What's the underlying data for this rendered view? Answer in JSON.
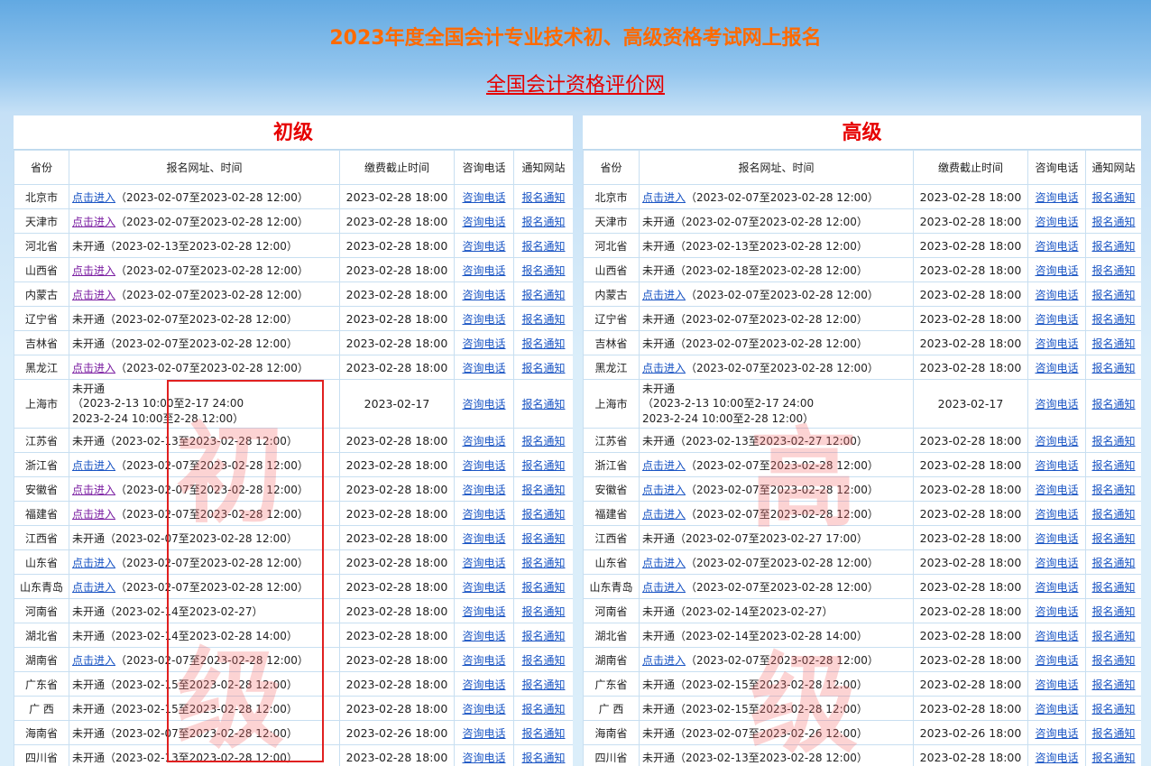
{
  "title": "2023年度全国会计专业技术初、高级资格考试网上报名",
  "site_link": "全国会计资格评价网",
  "headers": [
    "省份",
    "报名网址、时间",
    "缴费截止时间",
    "咨询电话",
    "通知网站"
  ],
  "consult_label": "咨询电话",
  "notice_label": "报名通知",
  "link_label": "点击进入",
  "watermarks": {
    "primary_top": "初",
    "primary_bottom": "级",
    "senior_top": "高",
    "senior_bottom": "级"
  },
  "colors": {
    "title": "#ff6a00",
    "link": "#1a55c4",
    "visited_link": "#7b1fa2",
    "panel_title": "#e60000",
    "highlight_box": "#e02020"
  },
  "primary": {
    "title": "初级",
    "rows": [
      {
        "province": "北京市",
        "status": "点击进入",
        "link": true,
        "visited": false,
        "period": "（2023-02-07至2023-02-28 12:00）",
        "deadline": "2023-02-28 18:00"
      },
      {
        "province": "天津市",
        "status": "点击进入",
        "link": true,
        "visited": true,
        "period": "（2023-02-07至2023-02-28 12:00）",
        "deadline": "2023-02-28 18:00"
      },
      {
        "province": "河北省",
        "status": "未开通",
        "link": false,
        "period": "（2023-02-13至2023-02-28 12:00）",
        "deadline": "2023-02-28 18:00"
      },
      {
        "province": "山西省",
        "status": "点击进入",
        "link": true,
        "visited": true,
        "period": "（2023-02-07至2023-02-28 12:00）",
        "deadline": "2023-02-28 18:00"
      },
      {
        "province": "内蒙古",
        "status": "点击进入",
        "link": true,
        "visited": true,
        "period": "（2023-02-07至2023-02-28 12:00）",
        "deadline": "2023-02-28 18:00"
      },
      {
        "province": "辽宁省",
        "status": "未开通",
        "link": false,
        "period": "（2023-02-07至2023-02-28 12:00）",
        "deadline": "2023-02-28 18:00"
      },
      {
        "province": "吉林省",
        "status": "未开通",
        "link": false,
        "period": "（2023-02-07至2023-02-28 12:00）",
        "deadline": "2023-02-28 18:00"
      },
      {
        "province": "黑龙江",
        "status": "点击进入",
        "link": true,
        "visited": true,
        "period": "（2023-02-07至2023-02-28 12:00）",
        "deadline": "2023-02-28 18:00"
      },
      {
        "province": "上海市",
        "status": "未开通",
        "link": false,
        "multi": true,
        "line2": "（2023-2-13 10:00至2-17 24:00",
        "line3": "2023-2-24 10:00至2-28 12:00）",
        "deadline": "2023-02-17"
      },
      {
        "province": "江苏省",
        "status": "未开通",
        "link": false,
        "period": "（2023-02-13至2023-02-28 12:00）",
        "deadline": "2023-02-28 18:00"
      },
      {
        "province": "浙江省",
        "status": "点击进入",
        "link": true,
        "visited": false,
        "period": "（2023-02-07至2023-02-28 12:00）",
        "deadline": "2023-02-28 18:00"
      },
      {
        "province": "安徽省",
        "status": "点击进入",
        "link": true,
        "visited": true,
        "period": "（2023-02-07至2023-02-28 12:00）",
        "deadline": "2023-02-28 18:00"
      },
      {
        "province": "福建省",
        "status": "点击进入",
        "link": true,
        "visited": true,
        "period": "（2023-02-07至2023-02-28 12:00）",
        "deadline": "2023-02-28 18:00"
      },
      {
        "province": "江西省",
        "status": "未开通",
        "link": false,
        "period": "（2023-02-07至2023-02-28 12:00）",
        "deadline": "2023-02-28 18:00"
      },
      {
        "province": "山东省",
        "status": "点击进入",
        "link": true,
        "visited": false,
        "period": "（2023-02-07至2023-02-28 12:00）",
        "deadline": "2023-02-28 18:00"
      },
      {
        "province": "山东青岛",
        "status": "点击进入",
        "link": true,
        "visited": false,
        "period": "（2023-02-07至2023-02-28 12:00）",
        "deadline": "2023-02-28 18:00"
      },
      {
        "province": "河南省",
        "status": "未开通",
        "link": false,
        "period": "（2023-02-14至2023-02-27）",
        "deadline": "2023-02-28 18:00"
      },
      {
        "province": "湖北省",
        "status": "未开通",
        "link": false,
        "period": "（2023-02-14至2023-02-28 14:00）",
        "deadline": "2023-02-28 18:00"
      },
      {
        "province": "湖南省",
        "status": "点击进入",
        "link": true,
        "visited": false,
        "period": "（2023-02-07至2023-02-28 12:00）",
        "deadline": "2023-02-28 18:00"
      },
      {
        "province": "广东省",
        "status": "未开通",
        "link": false,
        "period": "（2023-02-15至2023-02-28 12:00）",
        "deadline": "2023-02-28 18:00"
      },
      {
        "province": "广 西",
        "status": "未开通",
        "link": false,
        "period": "（2023-02-15至2023-02-28 12:00）",
        "deadline": "2023-02-28 18:00"
      },
      {
        "province": "海南省",
        "status": "未开通",
        "link": false,
        "period": "（2023-02-07至2023-02-28 12:00）",
        "deadline": "2023-02-26 18:00"
      },
      {
        "province": "四川省",
        "status": "未开通",
        "link": false,
        "period": "（2023-02-13至2023-02-28 12:00）",
        "deadline": "2023-02-28 18:00"
      }
    ]
  },
  "senior": {
    "title": "高级",
    "rows": [
      {
        "province": "北京市",
        "status": "点击进入",
        "link": true,
        "visited": false,
        "period": "（2023-02-07至2023-02-28 12:00）",
        "deadline": "2023-02-28 18:00"
      },
      {
        "province": "天津市",
        "status": "未开通",
        "link": false,
        "period": "（2023-02-07至2023-02-28 12:00）",
        "deadline": "2023-02-28 18:00"
      },
      {
        "province": "河北省",
        "status": "未开通",
        "link": false,
        "period": "（2023-02-13至2023-02-28 12:00）",
        "deadline": "2023-02-28 18:00"
      },
      {
        "province": "山西省",
        "status": "未开通",
        "link": false,
        "period": "（2023-02-18至2023-02-28 12:00）",
        "deadline": "2023-02-28 18:00"
      },
      {
        "province": "内蒙古",
        "status": "点击进入",
        "link": true,
        "visited": false,
        "period": "（2023-02-07至2023-02-28 12:00）",
        "deadline": "2023-02-28 18:00"
      },
      {
        "province": "辽宁省",
        "status": "未开通",
        "link": false,
        "period": "（2023-02-07至2023-02-28 12:00）",
        "deadline": "2023-02-28 18:00"
      },
      {
        "province": "吉林省",
        "status": "未开通",
        "link": false,
        "period": "（2023-02-07至2023-02-28 12:00）",
        "deadline": "2023-02-28 18:00"
      },
      {
        "province": "黑龙江",
        "status": "点击进入",
        "link": true,
        "visited": false,
        "period": "（2023-02-07至2023-02-28 12:00）",
        "deadline": "2023-02-28 18:00"
      },
      {
        "province": "上海市",
        "status": "未开通",
        "link": false,
        "multi": true,
        "line2": "（2023-2-13 10:00至2-17 24:00",
        "line3": "2023-2-24 10:00至2-28 12:00）",
        "deadline": "2023-02-17"
      },
      {
        "province": "江苏省",
        "status": "未开通",
        "link": false,
        "period": "（2023-02-13至2023-02-27 12:00）",
        "deadline": "2023-02-28 18:00"
      },
      {
        "province": "浙江省",
        "status": "点击进入",
        "link": true,
        "visited": false,
        "period": "（2023-02-07至2023-02-28 12:00）",
        "deadline": "2023-02-28 18:00"
      },
      {
        "province": "安徽省",
        "status": "点击进入",
        "link": true,
        "visited": false,
        "period": "（2023-02-07至2023-02-28 12:00）",
        "deadline": "2023-02-28 18:00"
      },
      {
        "province": "福建省",
        "status": "点击进入",
        "link": true,
        "visited": false,
        "period": "（2023-02-07至2023-02-28 12:00）",
        "deadline": "2023-02-28 18:00"
      },
      {
        "province": "江西省",
        "status": "未开通",
        "link": false,
        "period": "（2023-02-07至2023-02-27 17:00）",
        "deadline": "2023-02-28 18:00"
      },
      {
        "province": "山东省",
        "status": "点击进入",
        "link": true,
        "visited": false,
        "period": "（2023-02-07至2023-02-28 12:00）",
        "deadline": "2023-02-28 18:00"
      },
      {
        "province": "山东青岛",
        "status": "点击进入",
        "link": true,
        "visited": false,
        "period": "（2023-02-07至2023-02-28 12:00）",
        "deadline": "2023-02-28 18:00"
      },
      {
        "province": "河南省",
        "status": "未开通",
        "link": false,
        "period": "（2023-02-14至2023-02-27）",
        "deadline": "2023-02-28 18:00"
      },
      {
        "province": "湖北省",
        "status": "未开通",
        "link": false,
        "period": "（2023-02-14至2023-02-28 14:00）",
        "deadline": "2023-02-28 18:00"
      },
      {
        "province": "湖南省",
        "status": "点击进入",
        "link": true,
        "visited": false,
        "period": "（2023-02-07至2023-02-28 12:00）",
        "deadline": "2023-02-28 18:00"
      },
      {
        "province": "广东省",
        "status": "未开通",
        "link": false,
        "period": "（2023-02-15至2023-02-28 12:00）",
        "deadline": "2023-02-28 18:00"
      },
      {
        "province": "广 西",
        "status": "未开通",
        "link": false,
        "period": "（2023-02-15至2023-02-28 12:00）",
        "deadline": "2023-02-28 18:00"
      },
      {
        "province": "海南省",
        "status": "未开通",
        "link": false,
        "period": "（2023-02-07至2023-02-26 12:00）",
        "deadline": "2023-02-26 18:00"
      },
      {
        "province": "四川省",
        "status": "未开通",
        "link": false,
        "period": "（2023-02-13至2023-02-28 12:00）",
        "deadline": "2023-02-28 18:00"
      }
    ]
  }
}
